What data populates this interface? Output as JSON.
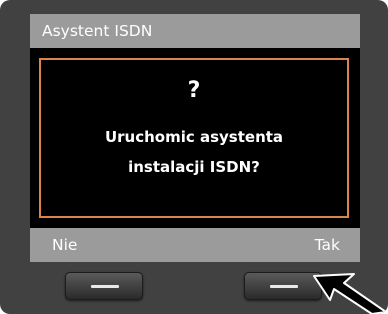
{
  "title_bar": {
    "title": "Asystent ISDN"
  },
  "dialog": {
    "icon": "question-mark",
    "symbol": "?",
    "line1": "Uruchomic asystenta",
    "line2": "instalacji ISDN?"
  },
  "softkeys": {
    "left_label": "Nie",
    "right_label": "Tak"
  },
  "colors": {
    "frame": "#d9844a",
    "title_bar": "#9b9b9b",
    "screen": "#000000",
    "housing": "#414141"
  }
}
